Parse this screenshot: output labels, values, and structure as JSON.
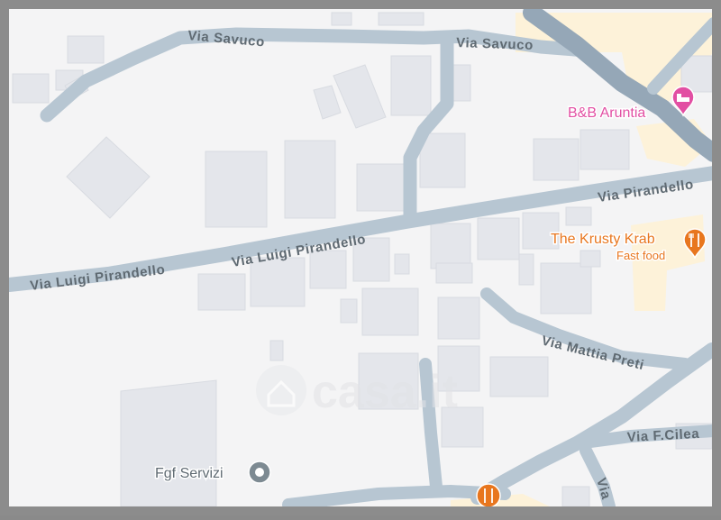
{
  "map": {
    "streets": {
      "savuco_west": "Via Savuco",
      "savuco_east": "Via Savuco",
      "pirandello_east": "Via Pirandello",
      "luigi_pirandello_mid": "Via Luigi Pirandello",
      "luigi_pirandello_west": "Via Luigi Pirandello",
      "mattia_preti": "Via Mattia Preti",
      "f_cilea": "Via F.Cilea",
      "south_vertical": "Via"
    },
    "pois": {
      "bb_aruntia": {
        "name": "B&B Aruntia",
        "icon": "bed-icon",
        "color": "#e24fa3"
      },
      "krusty_krab": {
        "name": "The Krusty Krab",
        "subtitle": "Fast food",
        "icon": "fork-knife-icon",
        "color": "#e8761e"
      },
      "fgf_servizi": {
        "name": "Fgf Servizi",
        "icon": "place-pin-icon",
        "color": "#7d8a92"
      },
      "restaurant_bottom": {
        "icon": "fork-knife-icon",
        "color": "#e8761e"
      }
    },
    "watermark": {
      "text": "casa.it",
      "icon": "house-icon"
    },
    "colors": {
      "background": "#f4f4f5",
      "building": "#e4e6eb",
      "road": "#b7c6d2",
      "major_road": "#95a7b7",
      "highlight_area": "#fdf2d9"
    }
  }
}
